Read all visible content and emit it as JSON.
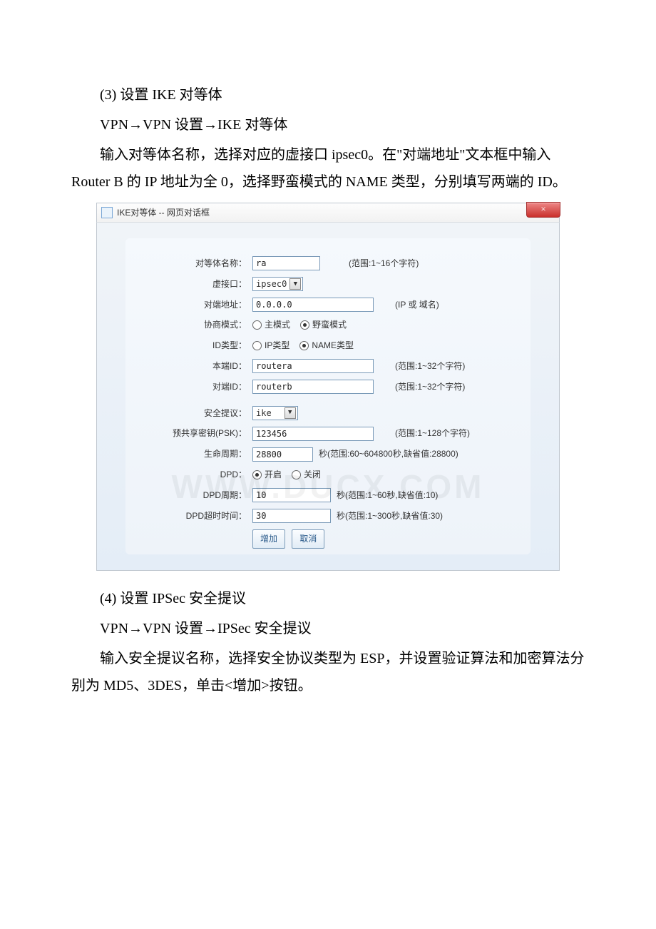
{
  "doc": {
    "p1": "(3) 设置 IKE 对等体",
    "p2": "VPN→VPN 设置→IKE 对等体",
    "p3": "输入对等体名称，选择对应的虚接口 ipsec0。在\"对端地址\"文本框中输入 Router B 的 IP 地址为全 0，选择野蛮模式的 NAME 类型，分别填写两端的 ID。",
    "p4": "(4) 设置 IPSec 安全提议",
    "p5": "VPN→VPN 设置→IPSec 安全提议",
    "p6": "输入安全提议名称，选择安全协议类型为 ESP，并设置验证算法和加密算法分别为 MD5、3DES，单击<增加>按钮。"
  },
  "dialog": {
    "title": "IKE对等体 -- 网页对话框",
    "close": "×",
    "labels": {
      "peername": "对等体名称：",
      "vif": "虚接口：",
      "remote": "对端地址：",
      "negomode": "协商模式：",
      "idtype": "ID类型：",
      "localid": "本端ID：",
      "remoteid": "对端ID：",
      "proposal": "安全提议：",
      "psk": "预共享密钥(PSK)：",
      "lifetime": "生命周期：",
      "dpd": "DPD：",
      "dpdperiod": "DPD周期：",
      "dpdtimeout": "DPD超时时间："
    },
    "values": {
      "peername": "ra",
      "vif": "ipsec0",
      "remote": "0.0.0.0",
      "localid": "routera",
      "remoteid": "routerb",
      "proposal": "ike",
      "psk": "123456",
      "lifetime": "28800",
      "dpdperiod": "10",
      "dpdtimeout": "30"
    },
    "radios": {
      "mode_main": "主模式",
      "mode_agg": "野蛮模式",
      "idtype_ip": "IP类型",
      "idtype_name": "NAME类型",
      "dpd_on": "开启",
      "dpd_off": "关闭"
    },
    "hints": {
      "peername": "(范围:1~16个字符)",
      "remote": "(IP 或 域名)",
      "localid": "(范围:1~32个字符)",
      "remoteid": "(范围:1~32个字符)",
      "psk": "(范围:1~128个字符)",
      "lifetime": "秒(范围:60~604800秒,缺省值:28800)",
      "dpdperiod": "秒(范围:1~60秒,缺省值:10)",
      "dpdtimeout": "秒(范围:1~300秒,缺省值:30)"
    },
    "buttons": {
      "add": "增加",
      "cancel": "取消"
    }
  },
  "watermark": "WWW.DUCX.COM"
}
